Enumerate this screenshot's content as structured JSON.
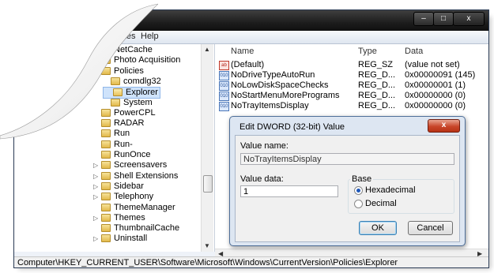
{
  "window": {
    "controls": {
      "minimize": "–",
      "maximize": "□",
      "close": "x"
    }
  },
  "menu": {
    "favorites": "avorites",
    "help": "Help"
  },
  "tree": {
    "items": [
      {
        "label": "NetCache",
        "indent": 2,
        "expander": ""
      },
      {
        "label": "Photo Acquisition",
        "indent": 2,
        "expander": ""
      },
      {
        "label": "Policies",
        "indent": 2,
        "expander": "◢"
      },
      {
        "label": "comdlg32",
        "indent": 3,
        "expander": ""
      },
      {
        "label": "Explorer",
        "indent": 3,
        "expander": "",
        "selected": true
      },
      {
        "label": "System",
        "indent": 3,
        "expander": ""
      },
      {
        "label": "PowerCPL",
        "indent": 2,
        "expander": ""
      },
      {
        "label": "RADAR",
        "indent": 2,
        "expander": ""
      },
      {
        "label": "Run",
        "indent": 2,
        "expander": ""
      },
      {
        "label": "Run-",
        "indent": 2,
        "expander": ""
      },
      {
        "label": "RunOnce",
        "indent": 2,
        "expander": ""
      },
      {
        "label": "Screensavers",
        "indent": 2,
        "expander": "▷"
      },
      {
        "label": "Shell Extensions",
        "indent": 2,
        "expander": "▷"
      },
      {
        "label": "Sidebar",
        "indent": 2,
        "expander": "▷"
      },
      {
        "label": "Telephony",
        "indent": 2,
        "expander": "▷"
      },
      {
        "label": "ThemeManager",
        "indent": 2,
        "expander": ""
      },
      {
        "label": "Themes",
        "indent": 2,
        "expander": "▷"
      },
      {
        "label": "ThumbnailCache",
        "indent": 2,
        "expander": ""
      },
      {
        "label": "Uninstall",
        "indent": 2,
        "expander": "▷"
      }
    ]
  },
  "list": {
    "columns": {
      "name": "Name",
      "type": "Type",
      "data": "Data"
    },
    "rows": [
      {
        "icon": "ab",
        "name": "(Default)",
        "type": "REG_SZ",
        "data": "(value not set)"
      },
      {
        "icon": "010",
        "name": "NoDriveTypeAutoRun",
        "type": "REG_D...",
        "data": "0x00000091 (145)"
      },
      {
        "icon": "010",
        "name": "NoLowDiskSpaceChecks",
        "type": "REG_D...",
        "data": "0x00000001 (1)"
      },
      {
        "icon": "010",
        "name": "NoStartMenuMorePrograms",
        "type": "REG_D...",
        "data": "0x00000000 (0)"
      },
      {
        "icon": "010",
        "name": "NoTrayItemsDisplay",
        "type": "REG_D...",
        "data": "0x00000000 (0)"
      }
    ]
  },
  "status": {
    "path": "Computer\\HKEY_CURRENT_USER\\Software\\Microsoft\\Windows\\CurrentVersion\\Policies\\Explorer"
  },
  "dialog": {
    "title": "Edit DWORD (32-bit) Value",
    "close": "x",
    "value_name_label": "Value name:",
    "value_name": "NoTrayItemsDisplay",
    "value_data_label": "Value data:",
    "value_data": "1",
    "base_label": "Base",
    "base_options": [
      {
        "label": "Hexadecimal",
        "selected": true
      },
      {
        "label": "Decimal",
        "selected": false
      }
    ],
    "ok": "OK",
    "cancel": "Cancel"
  }
}
